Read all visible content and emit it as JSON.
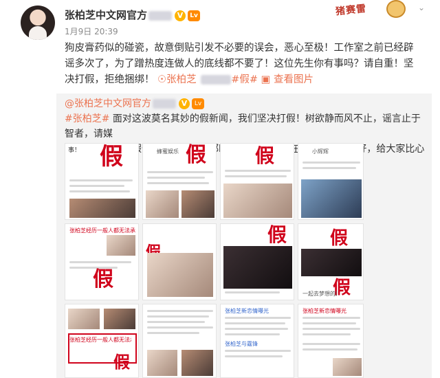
{
  "post": {
    "author": "张柏芝中文网官方",
    "verified_badge": "V",
    "level_badge": "Lv",
    "time": "1月9日 20:39",
    "sticker_text": "猪赛雷",
    "menu_icon": "chevron-down-icon",
    "text_lines": [
      "狗皮膏药似的碰瓷，故意倒贴引发不必要的误会，恶心至极！工作室之前已经辟",
      "谣多次了，为了蹭热度连做人的底线都不要了！这位先生你有事吗？请自重！坚",
      "决打假，拒绝捆绑！"
    ],
    "mention_link": "张柏芝",
    "topic_link": "#假#",
    "pics_link": "查看图片"
  },
  "repost": {
    "author": "@张柏芝中文网官方",
    "topic": "#张柏芝#",
    "text_lines": [
      " 面对这波莫名其妙的假新闻，我们坚决打假！树欲静而风不止，谣言止于智者，请媒",
      "体们不要散播虚假信息，因为看着都hin尴尬~美芝自在生活，风景独好，给大家比心"
    ],
    "heart_icon": "rose-icon",
    "fake_stamp": "假",
    "cell_headlines": [
      "事！",
      "张柏芝经历一般人都无法承受的事！",
      "张柏芝新恋情曝光",
      "蜂蜜娱乐",
      "小辉辉",
      "张柏芝与霆锋",
      "一起去梦想的路上"
    ]
  },
  "colors": {
    "link": "#eb7350",
    "fake_red": "#d0021b",
    "repost_bg": "#f3f3f3",
    "badge_gold": "#ffb300"
  }
}
